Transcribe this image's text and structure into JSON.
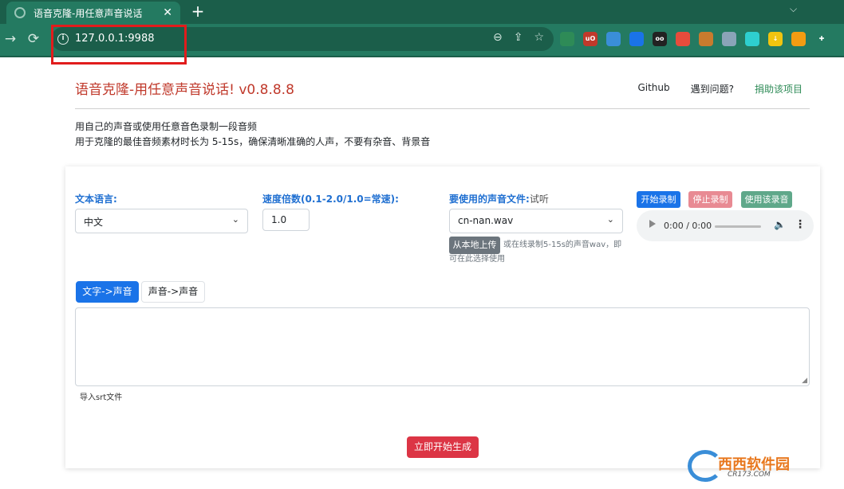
{
  "browser": {
    "tab_title": "语音克隆-用任意声音说话",
    "new_tab": "+",
    "url": "127.0.0.1:9988",
    "extensions": [
      {
        "name": "ext-1",
        "color": "#2e8b57",
        "text": ""
      },
      {
        "name": "ublock",
        "color": "#c0392b",
        "text": "uO"
      },
      {
        "name": "ext-3",
        "color": "#3a8ed8",
        "text": ""
      },
      {
        "name": "ext-4",
        "color": "#1a73e8",
        "text": ""
      },
      {
        "name": "ext-5",
        "color": "#222222",
        "text": "oo"
      },
      {
        "name": "ext-6",
        "color": "#e74c3c",
        "text": ""
      },
      {
        "name": "cookie",
        "color": "#c97b2e",
        "text": ""
      },
      {
        "name": "ext-8",
        "color": "#8aa4b8",
        "text": ""
      },
      {
        "name": "ext-9",
        "color": "#2ecfcf",
        "text": ""
      },
      {
        "name": "download",
        "color": "#f1c40f",
        "text": "↓"
      },
      {
        "name": "ext-11",
        "color": "#f39c12",
        "text": ""
      },
      {
        "name": "extensions-puzzle",
        "color": "#247a61",
        "text": "✚"
      }
    ]
  },
  "header": {
    "title": "语音克隆-用任意声音说话! v0.8.8.8",
    "links": {
      "github": "Github",
      "problem": "遇到问题?",
      "donate": "捐助该项目"
    }
  },
  "intro": {
    "line1": "用自己的声音或使用任意音色录制一段音频",
    "line2": "用于克隆的最佳音频素材时长为 5-15s，确保清晰准确的人声，不要有杂音、背景音"
  },
  "form": {
    "language_label": "文本语言:",
    "language_value": "中文",
    "speed_label": "速度倍数(0.1-2.0/1.0=常速):",
    "speed_value": "1.0",
    "voice_label": "要使用的声音文件:",
    "voice_preview": "试听",
    "voice_value": "cn-nan.wav",
    "upload_button": "从本地上传",
    "upload_hint": "或在线录制5-15s的声音wav，即可在此选择使用",
    "record_start": "开始录制",
    "record_stop": "停止录制",
    "record_use": "使用该录音",
    "audio_time": "0:00 / 0:00"
  },
  "tabs": {
    "text_to_voice": "文字->声音",
    "voice_to_voice": "声音->声音"
  },
  "srt_label": "导入srt文件",
  "generate_button": "立即开始生成",
  "watermark": {
    "big": "西西软件园",
    "small": "CR173.COM"
  }
}
